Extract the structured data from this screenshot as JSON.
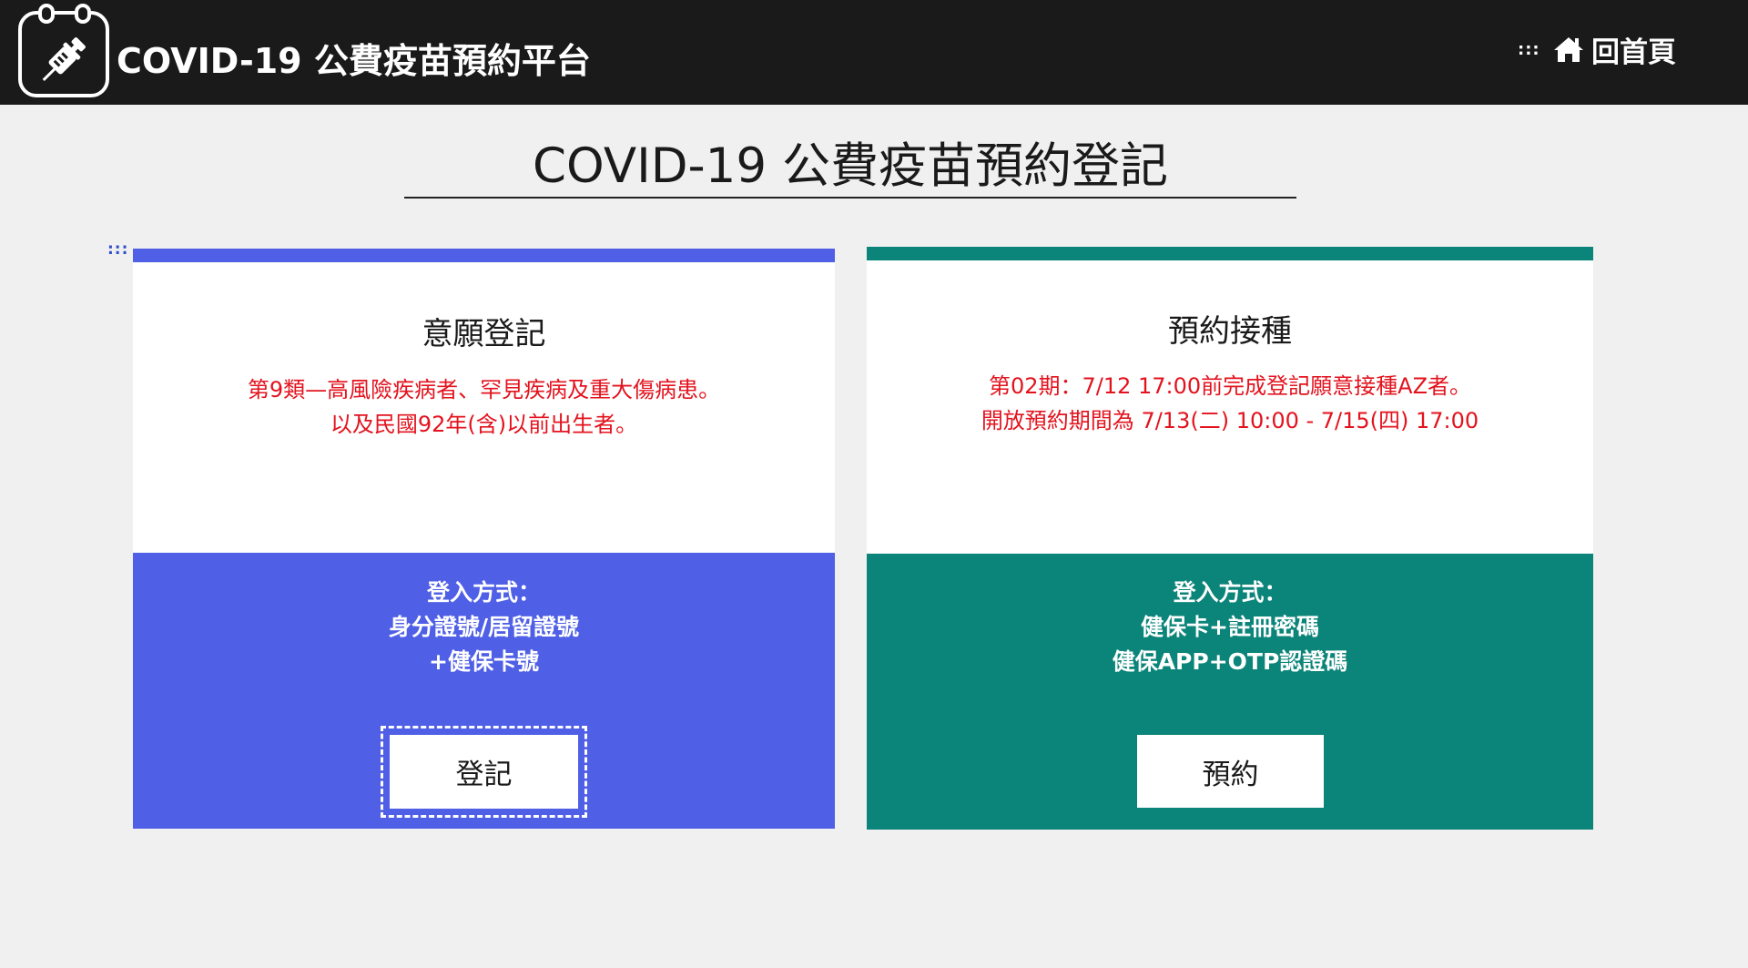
{
  "header": {
    "site_title": "COVID-19 公費疫苗預約平台",
    "skip_marker": ":::",
    "home_label": "回首頁"
  },
  "main": {
    "heading": "COVID-19 公費疫苗預約登記",
    "skip_marker": ":::"
  },
  "cards": [
    {
      "title": "意願登記",
      "notice": [
        "第9類—高風險疾病者、罕見疾病及重大傷病患。",
        "以及民國92年(含)以前出生者。"
      ],
      "login_lines": [
        "登入方式：",
        "身分證號/居留證號",
        "+健保卡號"
      ],
      "button_label": "登記",
      "accent_color": "#4f5fe6"
    },
    {
      "title": "預約接種",
      "notice": [
        "第02期：7/12 17:00前完成登記願意接種AZ者。",
        "開放預約期間為 7/13(二) 10:00 - 7/15(四) 17:00"
      ],
      "login_lines": [
        "登入方式：",
        "健保卡+註冊密碼",
        "健保APP+OTP認證碼"
      ],
      "button_label": "預約",
      "accent_color": "#0b8479"
    }
  ],
  "colors": {
    "topbar": "#1a1a1a",
    "background": "#f0f0f0",
    "notice_red": "#e3131e"
  }
}
